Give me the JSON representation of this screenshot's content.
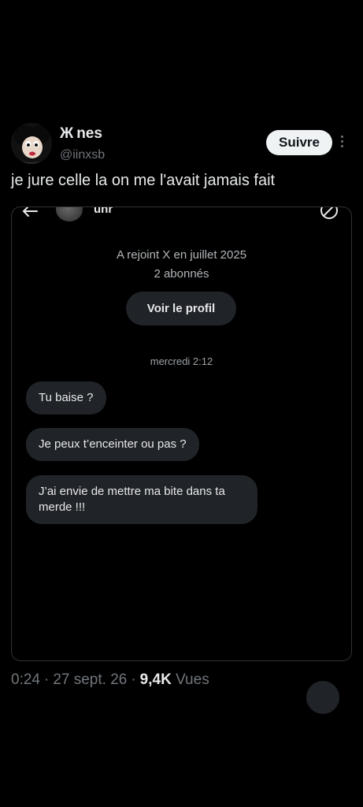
{
  "tweet": {
    "name_prefix": "Ж",
    "display_name": "nes",
    "handle": "@iinxsb",
    "follow_label": "Suivre",
    "text": "je jure celle la on me l'avait jamais fait"
  },
  "dm": {
    "contact_name": "unr",
    "joined": "A rejoint X en juillet 2025",
    "followers": "2 abonnés",
    "profile_button": "Voir le profil",
    "date": "mercredi 2:12",
    "messages": [
      "Tu baise ?",
      "Je peux t’enceinter ou pas ?",
      "J’ai envie de mettre ma bite dans ta merde !!!"
    ]
  },
  "meta": {
    "time": "0:24",
    "date": "27 sept. 26",
    "views_count": "9,4K",
    "views_label": "Vues",
    "separator": "·"
  },
  "colors": {
    "background": "#000000",
    "text": "#e7e9ea",
    "muted": "#71767b",
    "bubble": "#202327",
    "follow_button": "#eff3f4"
  },
  "icons": [
    "back-arrow-icon",
    "info-icon",
    "more-vertical-icon"
  ]
}
